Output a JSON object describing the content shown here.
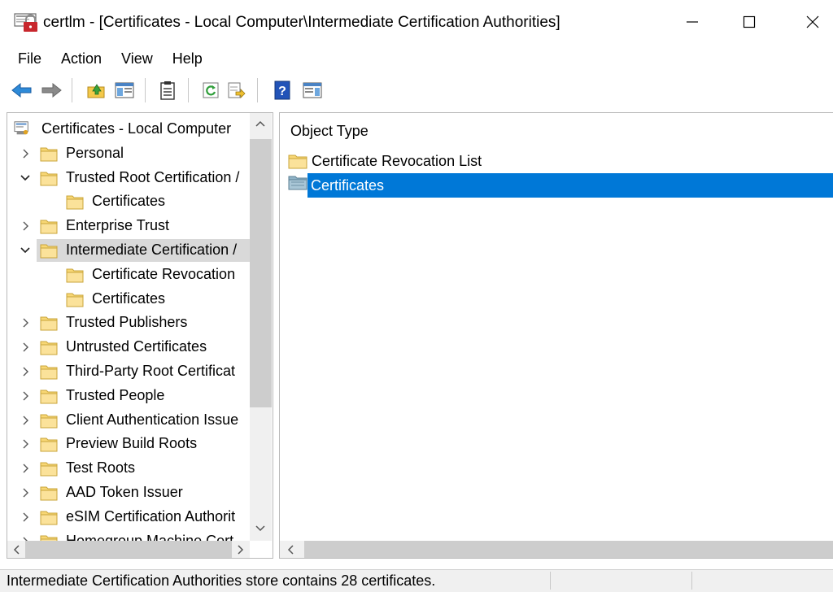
{
  "window": {
    "title": "certlm - [Certificates - Local Computer\\Intermediate Certification Authorities]",
    "minimize_glyph": "—",
    "maximize_glyph": "☐",
    "close_glyph": "✕"
  },
  "menu": [
    "File",
    "Action",
    "View",
    "Help"
  ],
  "toolbar": {
    "icons": [
      "back-arrow-icon",
      "forward-arrow-icon",
      "up-level-icon",
      "show-hide-console-tree-icon",
      "properties-icon",
      "refresh-icon",
      "export-list-icon",
      "help-icon",
      "show-action-pane-icon"
    ]
  },
  "tree": {
    "root": "Certificates - Local Computer",
    "nodes": [
      {
        "label": "Personal",
        "level": 1,
        "expander": "collapsed"
      },
      {
        "label": "Trusted Root Certification /",
        "level": 1,
        "expander": "expanded"
      },
      {
        "label": "Certificates",
        "level": 2,
        "expander": "none"
      },
      {
        "label": "Enterprise Trust",
        "level": 1,
        "expander": "collapsed"
      },
      {
        "label": "Intermediate Certification /",
        "level": 1,
        "expander": "expanded",
        "selected": true
      },
      {
        "label": "Certificate Revocation",
        "level": 2,
        "expander": "none"
      },
      {
        "label": "Certificates",
        "level": 2,
        "expander": "none"
      },
      {
        "label": "Trusted Publishers",
        "level": 1,
        "expander": "collapsed"
      },
      {
        "label": "Untrusted Certificates",
        "level": 1,
        "expander": "collapsed"
      },
      {
        "label": "Third-Party Root Certificat",
        "level": 1,
        "expander": "collapsed"
      },
      {
        "label": "Trusted People",
        "level": 1,
        "expander": "collapsed"
      },
      {
        "label": "Client Authentication Issue",
        "level": 1,
        "expander": "collapsed"
      },
      {
        "label": "Preview Build Roots",
        "level": 1,
        "expander": "collapsed"
      },
      {
        "label": "Test Roots",
        "level": 1,
        "expander": "collapsed"
      },
      {
        "label": "AAD Token Issuer",
        "level": 1,
        "expander": "collapsed"
      },
      {
        "label": "eSIM Certification Authorit",
        "level": 1,
        "expander": "collapsed"
      },
      {
        "label": "Homegroup Machine Cert",
        "level": 1,
        "expander": "collapsed"
      }
    ]
  },
  "list": {
    "column_header": "Object Type",
    "items": [
      {
        "label": "Certificate Revocation List",
        "selected": false
      },
      {
        "label": "Certificates",
        "selected": true
      }
    ]
  },
  "status": {
    "text": "Intermediate Certification Authorities store contains 28 certificates."
  },
  "colors": {
    "selection_blue": "#0078d7",
    "tree_selection_gray": "#d9d9d9",
    "folder_yellow": "#f8d775",
    "scrollbar_track": "#f0f0f0",
    "scrollbar_thumb": "#cdcdcd"
  }
}
